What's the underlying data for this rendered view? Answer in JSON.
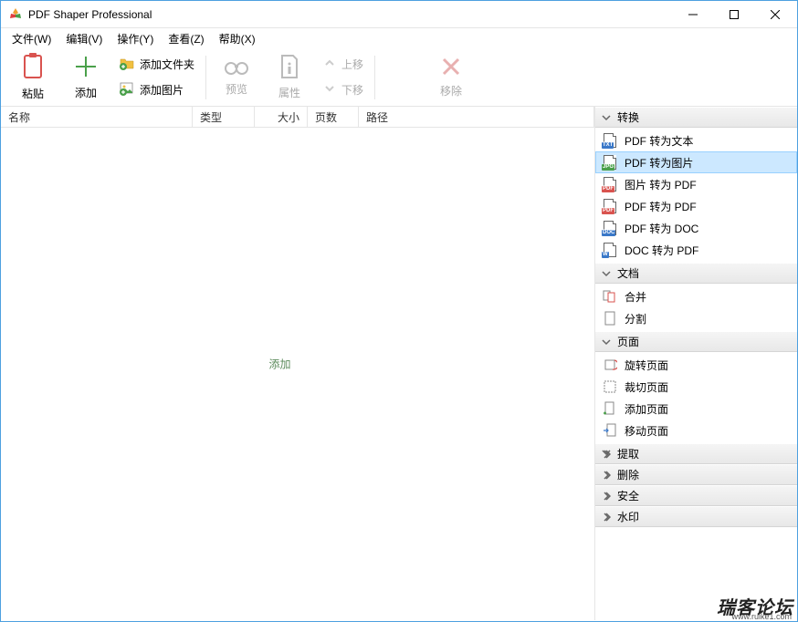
{
  "window": {
    "title": "PDF Shaper Professional"
  },
  "menu": {
    "file": "文件(W)",
    "edit": "编辑(V)",
    "action": "操作(Y)",
    "view": "查看(Z)",
    "help": "帮助(X)"
  },
  "toolbar": {
    "paste": "粘贴",
    "add": "添加",
    "add_folder": "添加文件夹",
    "add_image": "添加图片",
    "preview": "预览",
    "properties": "属性",
    "move_up": "上移",
    "move_down": "下移",
    "remove": "移除"
  },
  "columns": {
    "name": "名称",
    "type": "类型",
    "size": "大小",
    "pages": "页数",
    "path": "路径"
  },
  "empty_hint": "添加",
  "side": {
    "sections": {
      "convert": "转换",
      "document": "文档",
      "page": "页面",
      "extract": "提取",
      "delete": "删除",
      "security": "安全",
      "watermark": "水印"
    },
    "convert_items": {
      "pdf_to_text": "PDF 转为文本",
      "pdf_to_image": "PDF 转为图片",
      "image_to_pdf": "图片 转为 PDF",
      "pdf_to_pdf": "PDF 转为 PDF",
      "pdf_to_doc": "PDF 转为 DOC",
      "doc_to_pdf": "DOC 转为 PDF"
    },
    "document_items": {
      "merge": "合并",
      "split": "分割"
    },
    "page_items": {
      "rotate": "旋转页面",
      "crop": "裁切页面",
      "add": "添加页面",
      "move": "移动页面"
    }
  },
  "watermark_text": "瑞客论坛",
  "watermark_url": "www.ruike1.com"
}
